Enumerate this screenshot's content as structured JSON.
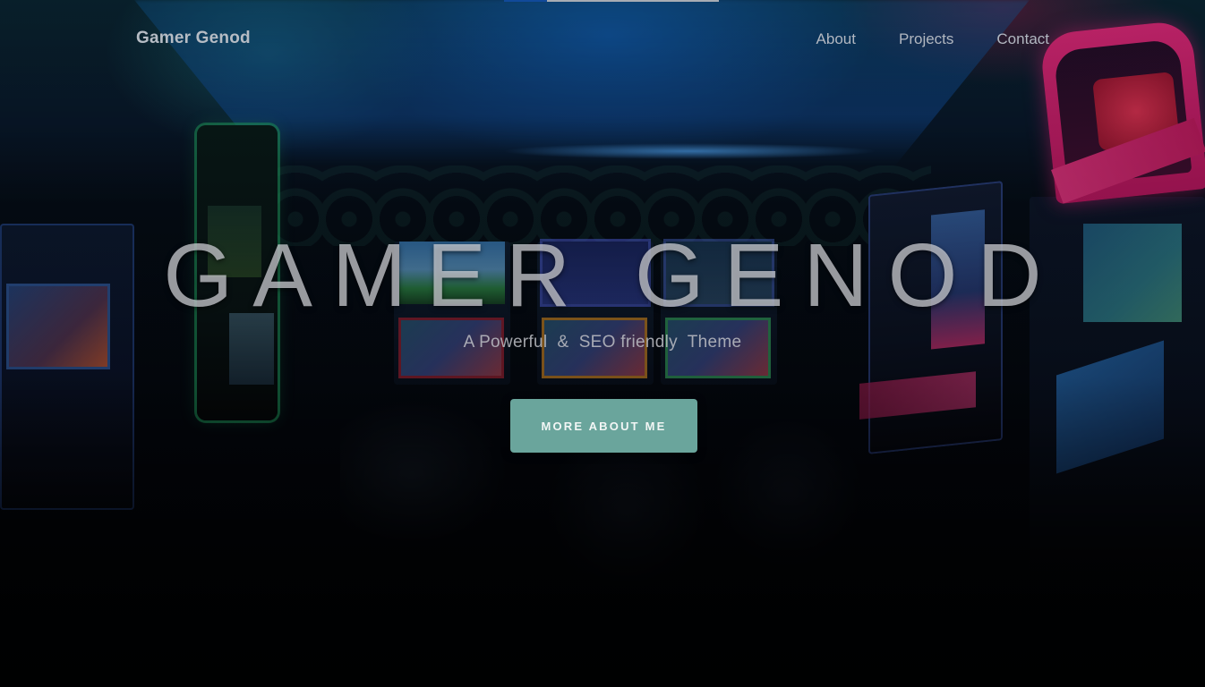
{
  "header": {
    "brand": "Gamer Genod",
    "nav": [
      {
        "label": "About"
      },
      {
        "label": "Projects"
      },
      {
        "label": "Contact"
      }
    ]
  },
  "hero": {
    "title": "GAMER GENOD",
    "subtitle": "A Powerful  &  SEO friendly  Theme",
    "cta_label": "MORE ABOUT ME",
    "background_image": "dark arcade room with neon-lit game machines"
  },
  "colors": {
    "cta_background": "#6aa59c",
    "nav_text": "#b1b7c0",
    "title_text": "#d2d4da"
  }
}
